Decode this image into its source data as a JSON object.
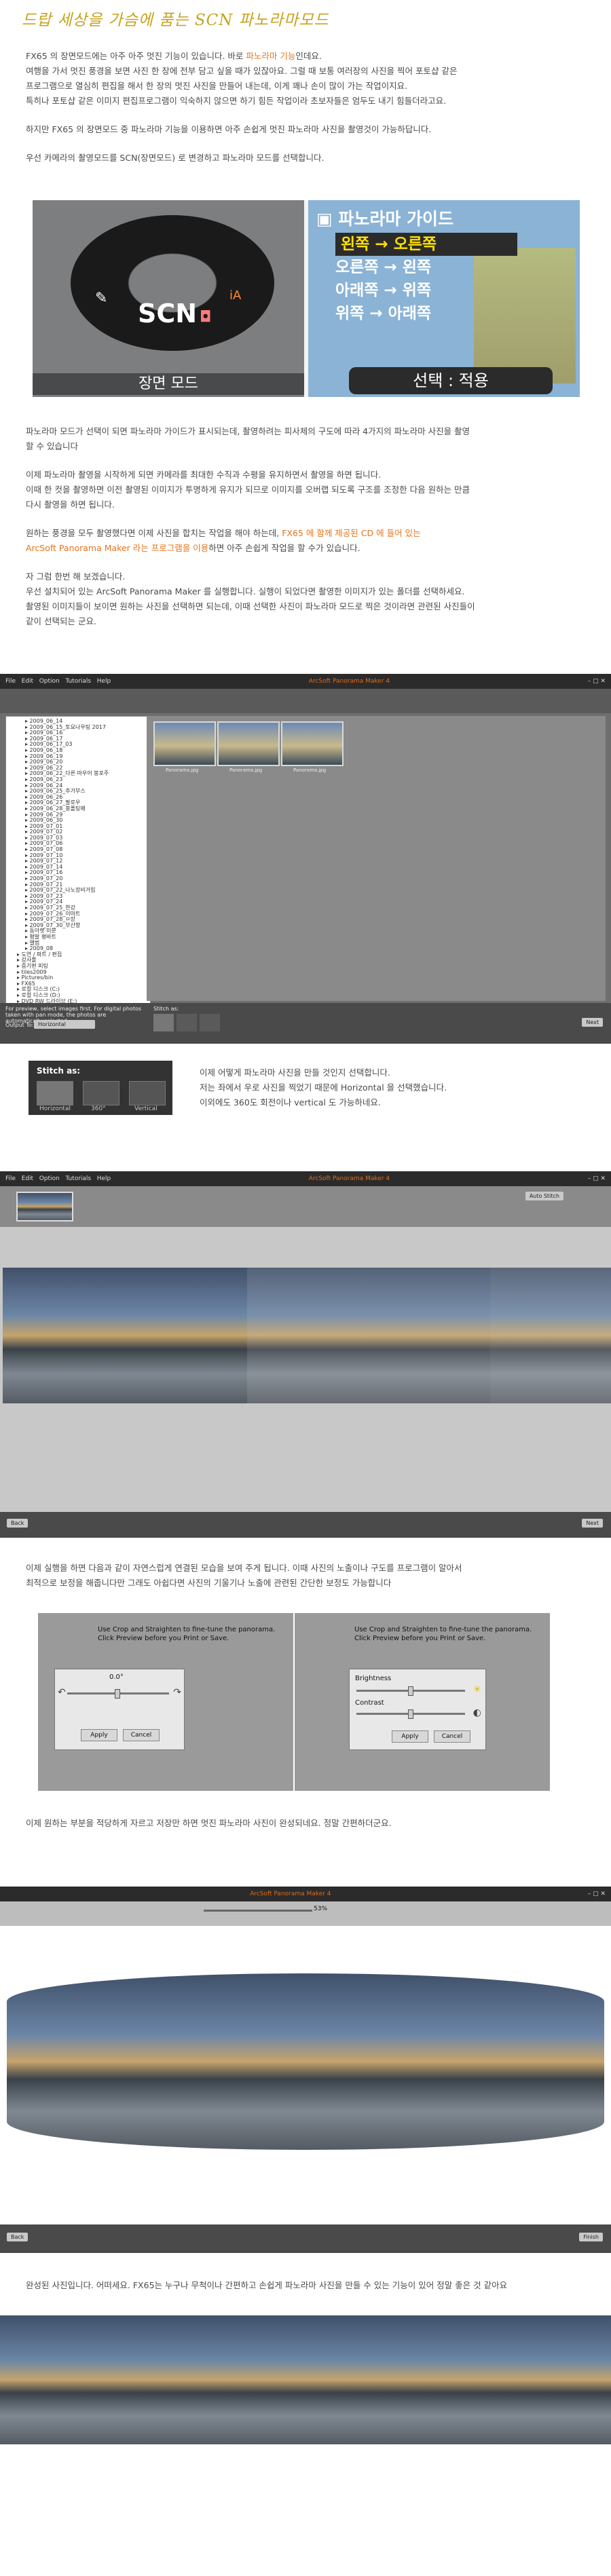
{
  "title": "드랍 세상을 가슴에 품는 SCN 파노라마모드",
  "intro": {
    "l1a": "FX65 의 장면모드에는 아주 아주 멋진 기능이 있습니다. 바로 ",
    "l1b": "파노라마 기능",
    "l1c": "인데요.",
    "l2": "여행을 가서 멋진 풍경을 보면 사진 한 장에 전부 담고 싶을 때가 있잖아요. 그럴 때 보통 여러장의 사진을 찍어 포토샵 같은",
    "l3": "프로그램으로 열심히 편집을 해서 한 장의 멋진 사진을 만들어 내는데, 이게 꽤나 손이 많이 가는 작업이지요.",
    "l4": "특히나 포토샵 같은 이미지 편집프로그램이 익숙하지 않으면 하기 힘든 작업이라 초보자들은 엄두도 내기 힘들더라고요.",
    "l5": "하지만 FX65 의 장면모드 중 파노라마 기능을 이용하면 아주 손쉽게 멋진 파노라마 사진을 촬영것이 가능하답니다.",
    "l6": "우선 카메라의 촬영모드를 SCN(장면모드) 로 변경하고 파노라마 모드를 선택합니다."
  },
  "camera": {
    "scn_text": "SCN",
    "scn_caption": "장면 모드",
    "guide_title": "파노라마 가이드",
    "options": [
      "왼쪽 → 오른쪽",
      "오른쪽 → 왼쪽",
      "아래쪽 → 위쪽",
      "위쪽 → 아래쪽"
    ],
    "footer": "선택 : 적용"
  },
  "para2": {
    "l1": "파노라마 모드가 선택이 되면 파노라마 가이드가 표시되는데, 촬영하려는 피사체의 구도에 따라 4가지의 파노라마 사진을 촬영",
    "l2": "할 수 있습니다",
    "l3": "이제 파노라마 촬영을 시작하게 되면 카메라를 최대한 수직과 수평을 유지하면서 촬영을 하면 됩니다.",
    "l4": "이때 한 컷을 촬영하면 이전 촬영된 이미지가 투명하게 유지가 되므로 이미지를 오버랩 되도록 구조를 조정한 다음 원하는 만큼",
    "l5": "다시 촬영을 하면 됩니다.",
    "l6a": "원하는 풍경을 모두 촬영했다면 이제 사진을 합치는 작업을 해야 하는데, ",
    "l6b": "FX65 에 함께 제공된 CD 에 들어 있는",
    "l7a": "ArcSoft Panorama Maker 라는 프로그램을 이용",
    "l7b": "하면 아주 손쉽게 작업을 할 수가 있습니다.",
    "l8": "자 그럼 한번 해 보겠습니다.",
    "l9": "우선 설치되어 있는 ArcSoft Panorama Maker 를 실행합니다. 실행이 되었다면 촬영한 이미지가 있는 폴더를 선택하세요.",
    "l10": "촬영된 이미지들이 보이면 원하는 사진을 선택하면 되는데, 이때 선택한 사진이 파노라마 모드로 찍은 것이라면 관련된 사진들이",
    "l11": "같이 선택되는 군요."
  },
  "app1": {
    "menu": [
      "File",
      "Edit",
      "Option",
      "Tutorials",
      "Help"
    ],
    "apptitle": "ArcSoft Panorama Maker 4",
    "folders": [
      "2009_06_14",
      "2009_06_15_토요나우팅 2017",
      "2009_06_16",
      "2009_06_17",
      "2009_06_17_03",
      "2009_06_18",
      "2009_06_19",
      "2009_06_20",
      "2009_06_22",
      "2009_06_22_다른 마우어 봉포주",
      "2009_06_23",
      "2009_06_24",
      "2009_06_25_추가부스",
      "2009_06_26",
      "2009_06_27_팔로우",
      "2009_06_28_봉폴팅매",
      "2009_06_29",
      "2009_06_30",
      "2009_07_01",
      "2009_07_02",
      "2009_07_03",
      "2009_07_06",
      "2009_07_08",
      "2009_07_10",
      "2009_07_12",
      "2009_07_14",
      "2009_07_16",
      "2009_07_20",
      "2009_07_21",
      "2009_07_22_나노장비거립",
      "2009_07_23",
      "2009_07_24",
      "2009_07_25_한강",
      "2009_07_26_이마트",
      "2009_07_28_ㅁ장",
      "2009_07_30_부산항",
      "동아랫 미분",
      "평발 평바트",
      "앨범",
      "2009_08",
      "도연 / 파트 / 편집",
      "강사폴",
      "증기편 피팅",
      "tiles2009",
      "Pictures/bin",
      "FX65",
      "로컬 디스크 (C:)",
      "로컬 디스크 (D:)",
      "DVD RW 드라이브 (E:)",
      "디지털 캐스팅",
      "네트워크",
      "휴지통",
      "동영상",
      "프로젝트"
    ],
    "thumb_caps": [
      "Panorama.jpg",
      "Panorama.jpg",
      "Panorama.jpg"
    ],
    "footer_hint": "For preview, select images first. For digital photos taken with pan mode, the photos are automatically selected.",
    "output_label": "Output To:",
    "output_value": "Horizontal",
    "stitch_label": "Stitch as:",
    "next_label": "Next"
  },
  "stitch": {
    "header": "Stitch as:",
    "options": [
      "Horizontal",
      "360°",
      "Vertical"
    ]
  },
  "para3": {
    "l1": "이제 어떻게 파노라마 사진을 만들 것인지 선택합니다.",
    "l2": "저는 좌에서 우로 사진을 찍었기 때문에 Horizontal 을 선택했습니다.",
    "l3": "이외에도 360도 회전이나 vertical 도 가능하네요."
  },
  "app2": {
    "menu": [
      "File",
      "Edit",
      "Option",
      "Tutorials",
      "Help"
    ],
    "apptitle": "ArcSoft Panorama Maker 4",
    "auto_label": "Auto Stitch",
    "back_label": "Back",
    "next_label": "Next"
  },
  "para4": {
    "l1": "이제 실행을 하면 다음과 같이 자연스럽게 연결된 모습을 보여 주게 됩니다. 이때 사진의 노출이나 구도를 프로그램이 알아서",
    "l2": "최적으로 보정을 해줍니다만 그래도 아쉽다면 사진의 기울기나 노출에 관련된 간단한 보정도 가능합니다"
  },
  "dialogs": {
    "msg1": "Use Crop and Straighten to fine-tune the panorama.",
    "msg2": "Click Preview before you Print or Save.",
    "angle": "0.0°",
    "apply": "Apply",
    "cancel": "Cancel",
    "brightness": "Brightness",
    "contrast": "Contrast"
  },
  "para5": {
    "l1": "이제 원하는 부분을 적당하게 자르고 저장만 하면 멋진 파노라마 사진이 완성되네요. 정말 간편하더군요."
  },
  "app3": {
    "apptitle": "ArcSoft Panorama Maker 4",
    "zoom": "53%",
    "back_label": "Back",
    "finish_label": "Finish"
  },
  "para6": {
    "l1": "완성된 사진입니다. 어떠세요. FX65는 누구나 무척이나 간편하고 손쉽게 파노라마 사진을 만들 수 있는 기능이 있어 정말 좋은 것 같아요"
  }
}
